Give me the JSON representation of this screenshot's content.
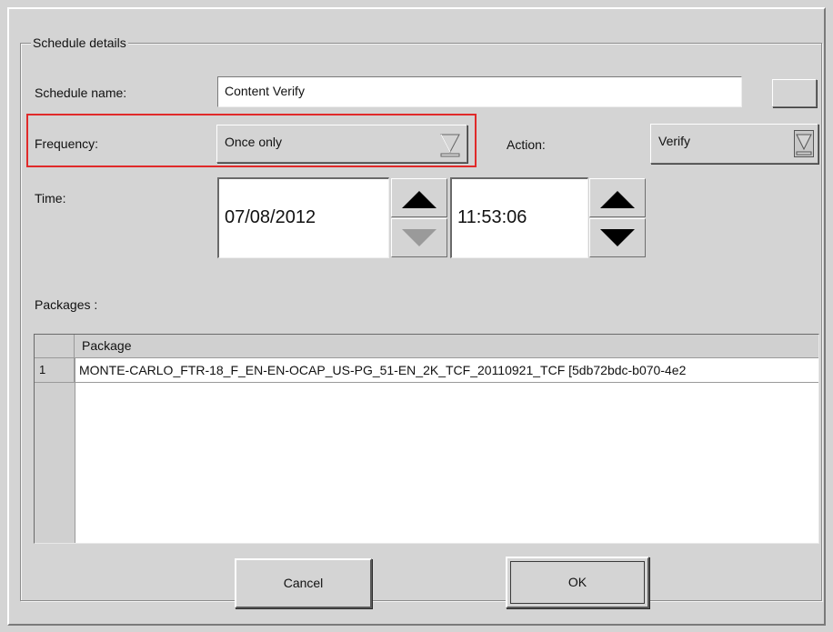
{
  "dialog": {
    "group_title": "Schedule details",
    "schedule_name_label": "Schedule name:",
    "schedule_name_value": "Content Verify",
    "frequency_label": "Frequency:",
    "frequency_value": "Once only",
    "action_label": "Action:",
    "action_value": "Verify",
    "time_label": "Time:",
    "date_value": "07/08/2012",
    "time_value": "11:53:06",
    "packages_label": "Packages :",
    "table": {
      "column_header": "Package",
      "rows": [
        {
          "num": "1",
          "package": "MONTE-CARLO_FTR-18_F_EN-EN-OCAP_US-PG_51-EN_2K_TCF_20110921_TCF [5db72bdc-b070-4e2"
        }
      ]
    },
    "cancel_label": "Cancel",
    "ok_label": "OK"
  },
  "icons": {
    "dropdown": "chevron-down-icon",
    "spin_up": "triangle-up-icon",
    "spin_down": "triangle-down-icon"
  },
  "colors": {
    "highlight": "#e02a2a",
    "panel": "#d4d4d4"
  }
}
